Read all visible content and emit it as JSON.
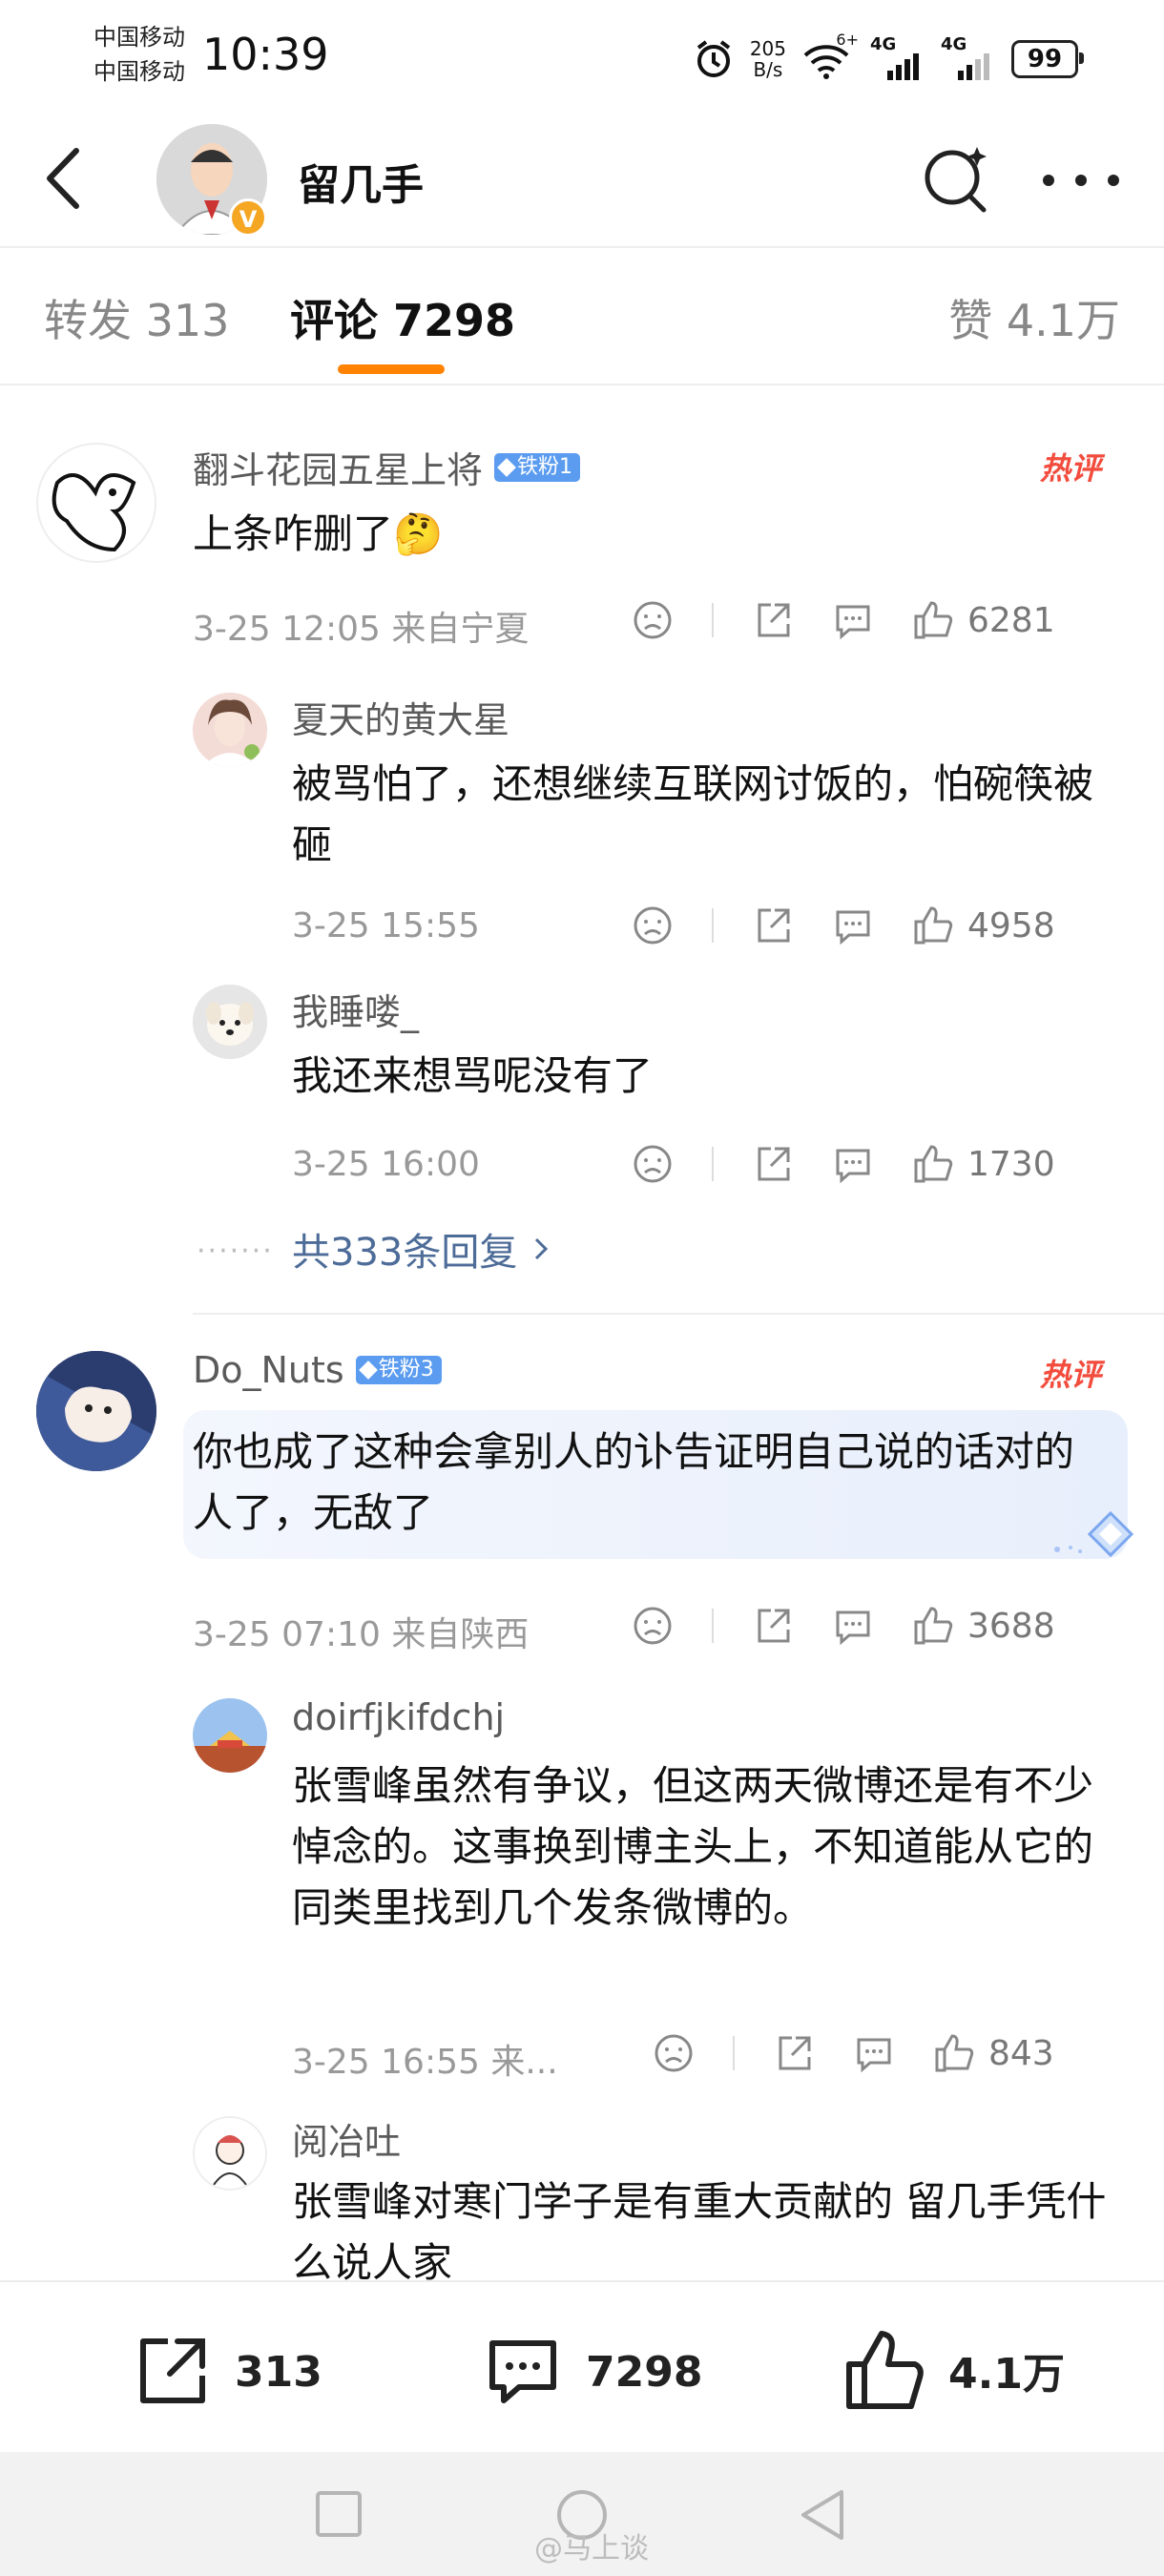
{
  "status_bar": {
    "carrier1": "中国移动",
    "carrier2": "中国移动",
    "time": "10:39",
    "net_speed_value": "205",
    "net_speed_unit": "B/s",
    "wifi_label": "6+",
    "signal1_label": "4G",
    "signal2_label": "4G",
    "battery": "99"
  },
  "header": {
    "title": "留几手",
    "verified_badge": "V"
  },
  "tabs": [
    {
      "label": "转发 313"
    },
    {
      "label": "评论 7298"
    },
    {
      "label": "赞 4.1万"
    }
  ],
  "comments": [
    {
      "username": "翻斗花园五星上将",
      "fan_badge": "铁粉1",
      "hot_label": "热评",
      "text": "上条咋删了🤔",
      "meta": "3-25 12:05 来自宁夏",
      "likes": "6281",
      "replies": [
        {
          "username": "夏天的黄大星",
          "text": "被骂怕了，还想继续互联网讨饭的，怕碗筷被砸",
          "meta": "3-25 15:55",
          "likes": "4958"
        },
        {
          "username": "我睡喽_",
          "text": "我还来想骂呢没有了",
          "meta": "3-25 16:00",
          "likes": "1730"
        }
      ],
      "more_replies": "共333条回复"
    },
    {
      "username": "Do_Nuts",
      "fan_badge": "铁粉3",
      "hot_label": "热评",
      "text": "你也成了这种会拿别人的讣告证明自己说的话对的人了，无敌了",
      "meta": "3-25 07:10 来自陕西",
      "likes": "3688",
      "replies": [
        {
          "username": "doirfjkifdchj",
          "text": "张雪峰虽然有争议，但这两天微博还是有不少悼念的。这事换到博主头上，不知道能从它的同类里找到几个发条微博的。",
          "meta": "3-25 16:55 来...",
          "likes": "843"
        },
        {
          "username": "阅冶吐",
          "text": "张雪峰对寒门学子是有重大贡献的 留几手凭什么说人家"
        }
      ]
    }
  ],
  "bottom_bar": {
    "repost_count": "313",
    "comment_count": "7298",
    "like_count": "4.1万"
  },
  "watermark": "@马上谈",
  "colors": {
    "accent": "#ff8200",
    "hot": "#f24c3d",
    "fan_badge": "#5b9cf0",
    "link": "#4d6c98"
  }
}
